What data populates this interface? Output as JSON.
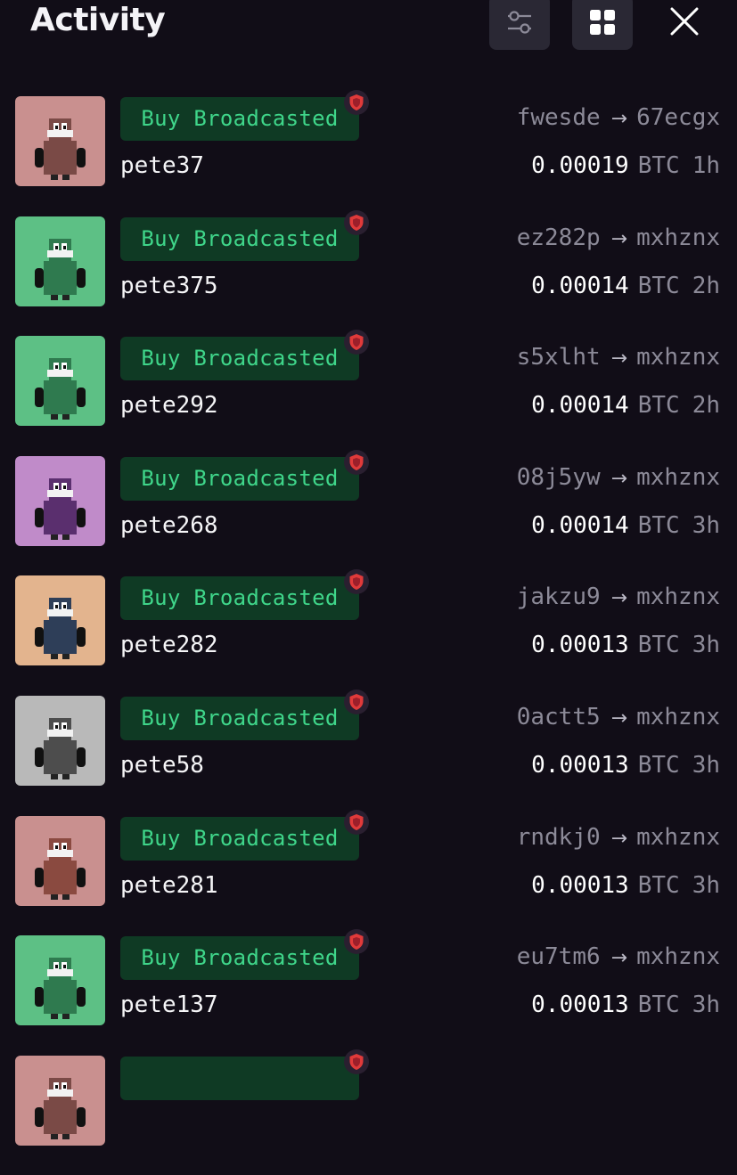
{
  "header": {
    "title": "Activity",
    "icons": {
      "filter": "sliders-icon",
      "view": "grid-icon",
      "close": "close-icon"
    }
  },
  "colors": {
    "background": "#110d17",
    "badge_bg": "#0f3a24",
    "badge_text": "#3fd68a",
    "muted": "#8c8a98",
    "shield": "#e03a3a"
  },
  "activities": [
    {
      "badge": "Buy Broadcasted",
      "name": "pete37",
      "from": "fwesde",
      "arrow": "→",
      "to": "67ecgx",
      "amount": "0.00019",
      "currency": "BTC",
      "ago": "1h",
      "avatar_bg": "#c9908f",
      "avatar_body": "#7a4a46",
      "avatar_icon": "pixel-avatar-icon"
    },
    {
      "badge": "Buy Broadcasted",
      "name": "pete375",
      "from": "ez282p",
      "arrow": "→",
      "to": "mxhznx",
      "amount": "0.00014",
      "currency": "BTC",
      "ago": "2h",
      "avatar_bg": "#5dc085",
      "avatar_body": "#2f7a4f",
      "avatar_icon": "pixel-avatar-icon"
    },
    {
      "badge": "Buy Broadcasted",
      "name": "pete292",
      "from": "s5xlht",
      "arrow": "→",
      "to": "mxhznx",
      "amount": "0.00014",
      "currency": "BTC",
      "ago": "2h",
      "avatar_bg": "#5dc085",
      "avatar_body": "#2f7a4f",
      "avatar_icon": "pixel-avatar-icon"
    },
    {
      "badge": "Buy Broadcasted",
      "name": "pete268",
      "from": "08j5yw",
      "arrow": "→",
      "to": "mxhznx",
      "amount": "0.00014",
      "currency": "BTC",
      "ago": "3h",
      "avatar_bg": "#c08bc9",
      "avatar_body": "#5a2f6e",
      "avatar_icon": "pixel-avatar-icon"
    },
    {
      "badge": "Buy Broadcasted",
      "name": "pete282",
      "from": "jakzu9",
      "arrow": "→",
      "to": "mxhznx",
      "amount": "0.00013",
      "currency": "BTC",
      "ago": "3h",
      "avatar_bg": "#e3b48e",
      "avatar_body": "#2e3e58",
      "avatar_icon": "pixel-avatar-icon"
    },
    {
      "badge": "Buy Broadcasted",
      "name": "pete58",
      "from": "0actt5",
      "arrow": "→",
      "to": "mxhznx",
      "amount": "0.00013",
      "currency": "BTC",
      "ago": "3h",
      "avatar_bg": "#b9b9b9",
      "avatar_body": "#4d4d4d",
      "avatar_icon": "pixel-avatar-icon"
    },
    {
      "badge": "Buy Broadcasted",
      "name": "pete281",
      "from": "rndkj0",
      "arrow": "→",
      "to": "mxhznx",
      "amount": "0.00013",
      "currency": "BTC",
      "ago": "3h",
      "avatar_bg": "#c9908f",
      "avatar_body": "#8a4a40",
      "avatar_icon": "pixel-avatar-icon"
    },
    {
      "badge": "Buy Broadcasted",
      "name": "pete137",
      "from": "eu7tm6",
      "arrow": "→",
      "to": "mxhznx",
      "amount": "0.00013",
      "currency": "BTC",
      "ago": "3h",
      "avatar_bg": "#5dc085",
      "avatar_body": "#2f7a4f",
      "avatar_icon": "pixel-avatar-icon"
    },
    {
      "badge": "",
      "name": "",
      "from": "",
      "arrow": "",
      "to": "",
      "amount": "",
      "currency": "",
      "ago": "",
      "avatar_bg": "#c9908f",
      "avatar_body": "#7a4a46",
      "avatar_icon": "pixel-avatar-icon"
    }
  ]
}
